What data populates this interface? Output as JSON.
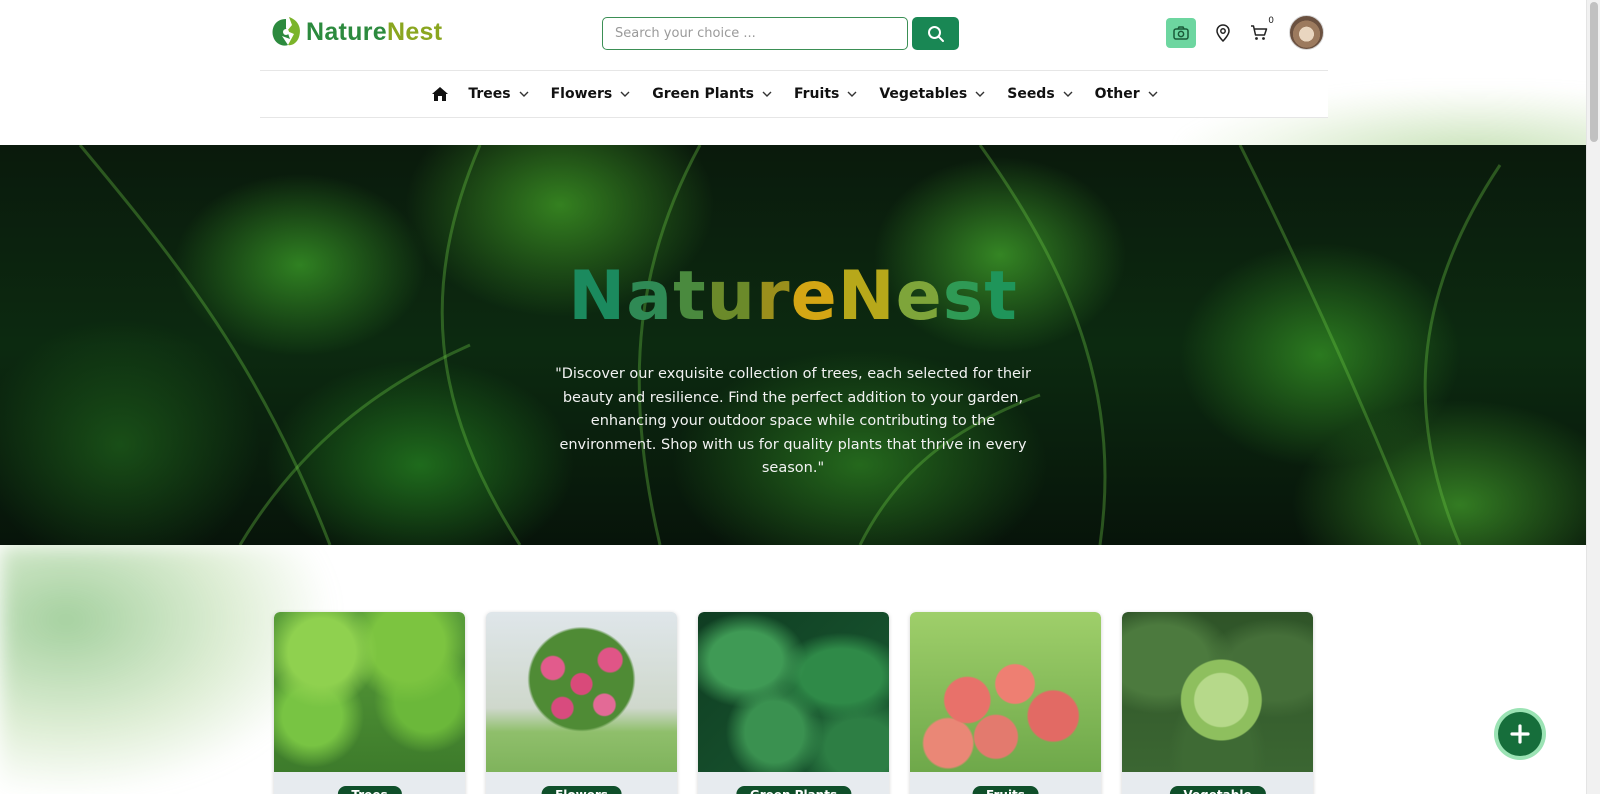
{
  "brand": {
    "name_part1": "Nature",
    "name_part2": "Nest"
  },
  "search": {
    "placeholder": "Search your choice ..."
  },
  "header": {
    "cart_count": "0"
  },
  "nav": {
    "items": [
      {
        "label": "Trees"
      },
      {
        "label": "Flowers"
      },
      {
        "label": "Green Plants"
      },
      {
        "label": "Fruits"
      },
      {
        "label": "Vegetables"
      },
      {
        "label": "Seeds"
      },
      {
        "label": "Other"
      }
    ]
  },
  "hero": {
    "title_letters": [
      "N",
      "a",
      "t",
      "u",
      "r",
      "e",
      "N",
      "e",
      "s",
      "t"
    ],
    "title_colors": [
      "#1b8a5e",
      "#2f8a55",
      "#4a8a3e",
      "#6b8a2a",
      "#9a8f1c",
      "#d4a614",
      "#b7a81a",
      "#7ea53a",
      "#2f9a55",
      "#1f955a"
    ],
    "text": "\"Discover our exquisite collection of trees, each selected for their beauty and resilience. Find the perfect addition to your garden, enhancing your outdoor space while contributing to the environment. Shop with us for quality plants that thrive in every season.\""
  },
  "categories": [
    {
      "label": "Trees"
    },
    {
      "label": "Flowers"
    },
    {
      "label": "Green Plants"
    },
    {
      "label": "Fruits"
    },
    {
      "label": "Vegetable"
    }
  ],
  "colors": {
    "primary": "#198754",
    "camera_button": "#6dd6a0",
    "label_bg": "#0f4f2a"
  },
  "icons": {
    "logo": "leaf-logo-icon",
    "search": "search-icon",
    "camera": "camera-icon",
    "location": "location-pin-icon",
    "cart": "cart-icon",
    "home": "home-icon",
    "chevron": "chevron-down-icon",
    "fab": "plus-icon"
  }
}
